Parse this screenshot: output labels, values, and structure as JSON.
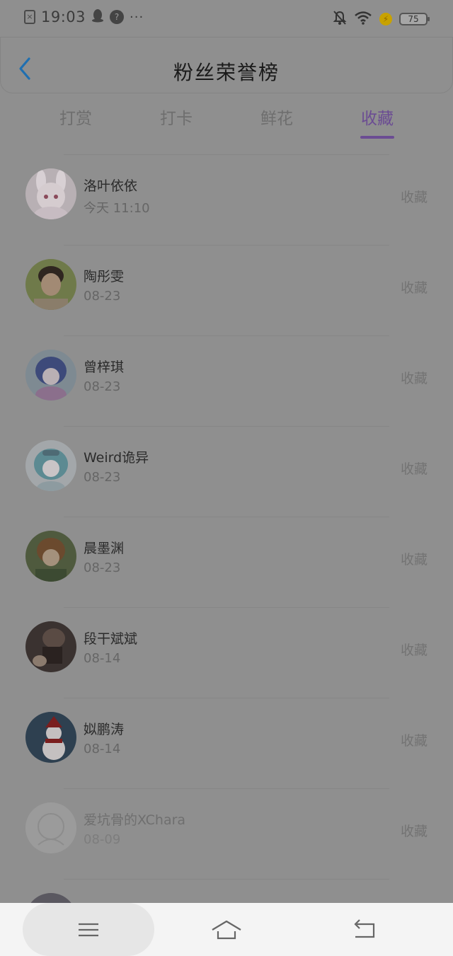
{
  "status_bar": {
    "time": "19:03",
    "battery_level": "75",
    "icons": [
      "sim-icon",
      "qq-penguin-icon",
      "app-badge-icon",
      "more-dots-icon",
      "mute-bell-icon",
      "wifi-icon",
      "charging-icon",
      "battery-icon"
    ]
  },
  "header": {
    "title": "粉丝荣誉榜",
    "back_icon": "chevron-left-icon"
  },
  "tabs": [
    {
      "label": "打赏",
      "active": false
    },
    {
      "label": "打卡",
      "active": false
    },
    {
      "label": "鲜花",
      "active": false
    },
    {
      "label": "收藏",
      "active": true
    }
  ],
  "colors": {
    "overlay_bg": "#8f8f8f",
    "active_tab": "#6b4c93",
    "back_icon": "#1f6fb0"
  },
  "list": [
    {
      "name": "洛叶依依",
      "date": "今天 11:10",
      "action": "收藏",
      "avatar": "anime-bunny-girl-avatar"
    },
    {
      "name": "陶彤雯",
      "date": "08-23",
      "action": "收藏",
      "avatar": "boy-photo-avatar"
    },
    {
      "name": "曾梓琪",
      "date": "08-23",
      "action": "收藏",
      "avatar": "anime-blue-hair-avatar"
    },
    {
      "name": "Weird诡异",
      "date": "08-23",
      "action": "收藏",
      "avatar": "anime-teal-hair-avatar"
    },
    {
      "name": "晨墨渊",
      "date": "08-23",
      "action": "收藏",
      "avatar": "anime-brown-hair-avatar"
    },
    {
      "name": "段干斌斌",
      "date": "08-14",
      "action": "收藏",
      "avatar": "dark-photo-avatar"
    },
    {
      "name": "姒鹏涛",
      "date": "08-14",
      "action": "收藏",
      "avatar": "snowman-avatar"
    },
    {
      "name": "爱坑骨的XChara",
      "date": "08-09",
      "action": "收藏",
      "avatar": "sketch-avatar"
    },
    {
      "name": "",
      "date": "",
      "action": "",
      "avatar": "partial-avatar"
    }
  ],
  "nav_bar": {
    "icons": [
      "menu-icon",
      "home-icon",
      "back-icon"
    ]
  }
}
